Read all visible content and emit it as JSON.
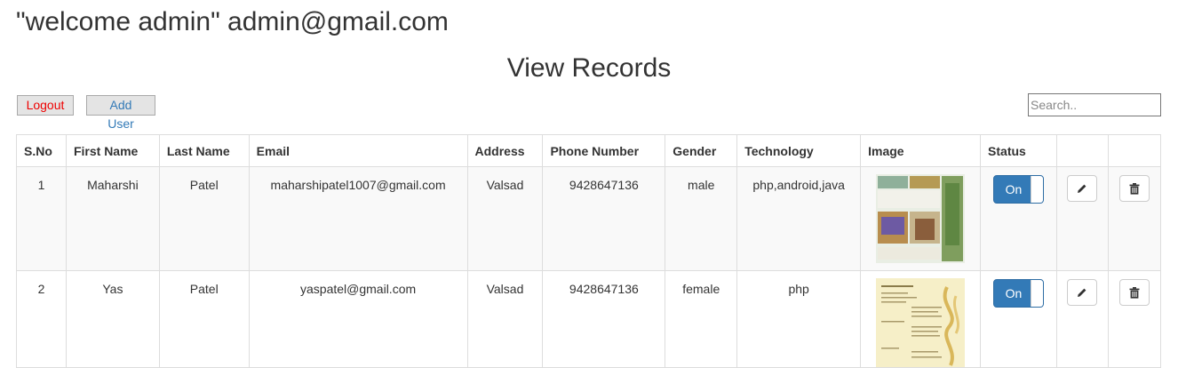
{
  "header": {
    "welcome": "\"welcome admin\" admin@gmail.com",
    "title": "View Records"
  },
  "toolbar": {
    "logout_label": "Logout",
    "adduser_label": "Add User",
    "search_placeholder": "Search.."
  },
  "table": {
    "columns": [
      "S.No",
      "First Name",
      "Last Name",
      "Email",
      "Address",
      "Phone Number",
      "Gender",
      "Technology",
      "Image",
      "Status"
    ],
    "rows": [
      {
        "sno": "1",
        "first": "Maharshi",
        "last": "Patel",
        "email": "maharshipatel1007@gmail.com",
        "address": "Valsad",
        "phone": "9428647136",
        "gender": "male",
        "tech": "php,android,java",
        "status": "On"
      },
      {
        "sno": "2",
        "first": "Yas",
        "last": "Patel",
        "email": "yaspatel@gmail.com",
        "address": "Valsad",
        "phone": "9428647136",
        "gender": "female",
        "tech": "php",
        "status": "On"
      }
    ]
  },
  "icons": {
    "edit": "pencil-icon",
    "delete": "trash-icon"
  },
  "colors": {
    "primary": "#337ab7",
    "logout": "#ee0000"
  }
}
